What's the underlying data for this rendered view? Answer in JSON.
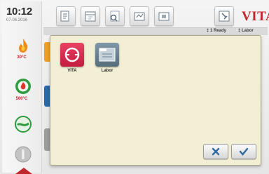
{
  "status": {
    "time": "10:12",
    "date": "07.06.2016"
  },
  "sidebar": {
    "items": [
      {
        "icon": "flame-icon",
        "label": "30°C"
      },
      {
        "icon": "vacuum-icon",
        "label": "500°C"
      },
      {
        "icon": "wave-icon",
        "label": ""
      },
      {
        "icon": "power-icon",
        "label": ""
      }
    ]
  },
  "toolbar": {
    "buttons": [
      "program-icon",
      "calendar-icon",
      "search-icon",
      "firing-icon",
      "camera-icon",
      "settings-icon"
    ],
    "brand": "VITA"
  },
  "status_strip": {
    "ready": "‡ 1 Ready",
    "labor": "‡ Labor"
  },
  "dialog": {
    "tiles": [
      {
        "name": "VITA",
        "color": "#d8264a"
      },
      {
        "name": "Labor",
        "color": "#607784"
      }
    ],
    "cancel_icon": "close-icon",
    "confirm_icon": "check-icon"
  }
}
